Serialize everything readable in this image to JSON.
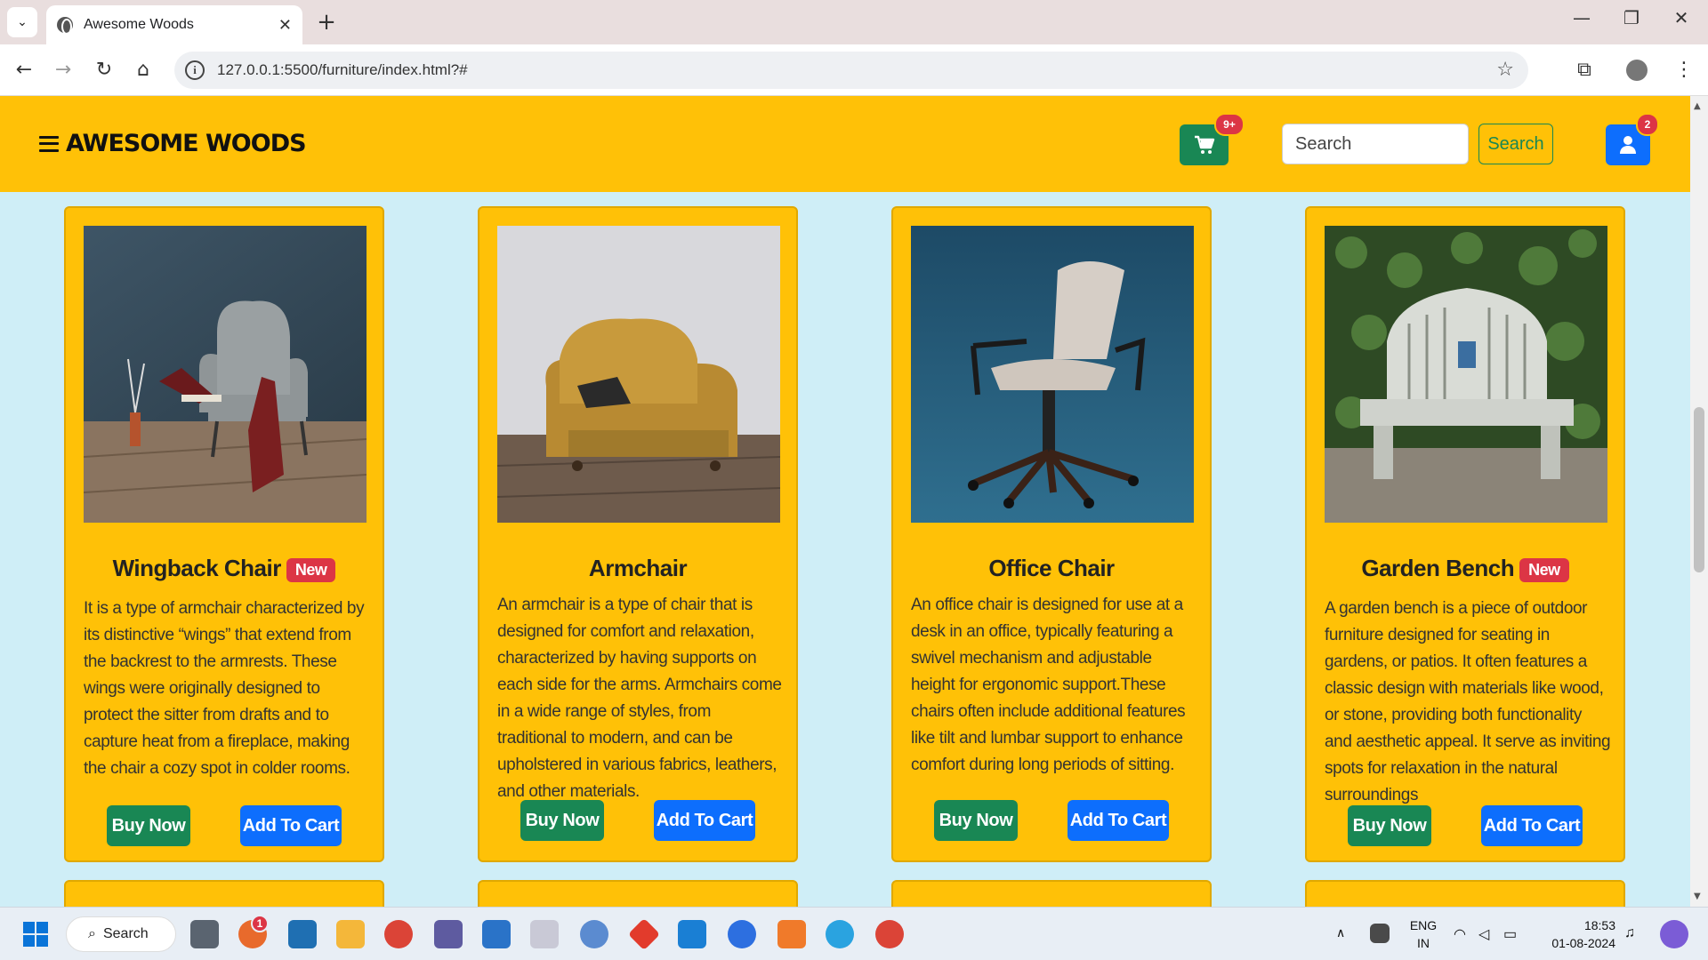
{
  "browser": {
    "tab_title": "Awesome Woods",
    "url": "127.0.0.1:5500/furniture/index.html?#",
    "new_tab_glyph": "+",
    "close_glyph": "✕",
    "minimize_glyph": "—",
    "restore_glyph": "❐",
    "window_close_glyph": "✕"
  },
  "header": {
    "brand": "AWESOME WOODS",
    "cart_badge": "9+",
    "search_placeholder": "Search",
    "search_button": "Search",
    "user_badge": "2",
    "colors": {
      "bar": "#ffc107",
      "cart": "#198754",
      "user": "#0d6efd",
      "badge": "#dc3545"
    }
  },
  "products": [
    {
      "title": "Wingback Chair",
      "badge": "New",
      "description": "It is a type of armchair characterized by its distinctive “wings” that extend from the backrest to the armrests. These wings were originally designed to protect the sitter from drafts and to capture heat from a fireplace, making the chair a cozy spot in colder rooms.",
      "buy_label": "Buy Now",
      "cart_label": "Add To Cart"
    },
    {
      "title": "Armchair",
      "badge": "",
      "description": "An armchair is a type of chair that is designed for comfort and relaxation, characterized by having supports on each side for the arms. Armchairs come in a wide range of styles, from traditional to modern, and can be upholstered in various fabrics, leathers, and other materials.",
      "buy_label": "Buy Now",
      "cart_label": "Add To Cart"
    },
    {
      "title": "Office Chair",
      "badge": "",
      "description": "An office chair is designed for use at a desk in an office, typically featuring a swivel mechanism and adjustable height for ergonomic support.These chairs often include additional features like tilt and lumbar support to enhance comfort during long periods of sitting.",
      "buy_label": "Buy Now",
      "cart_label": "Add To Cart"
    },
    {
      "title": "Garden Bench",
      "badge": "New",
      "description": "A garden bench is a piece of outdoor furniture designed for seating in gardens, or patios. It often features a classic design with materials like wood, or stone, providing both functionality and aesthetic appeal. It serve as inviting spots for relaxation in the natural surroundings",
      "buy_label": "Buy Now",
      "cart_label": "Add To Cart"
    }
  ],
  "taskbar": {
    "search_label": "Search",
    "language": "ENG",
    "region": "IN",
    "time": "18:53",
    "date": "01-08-2024",
    "notification_badge": "1"
  }
}
